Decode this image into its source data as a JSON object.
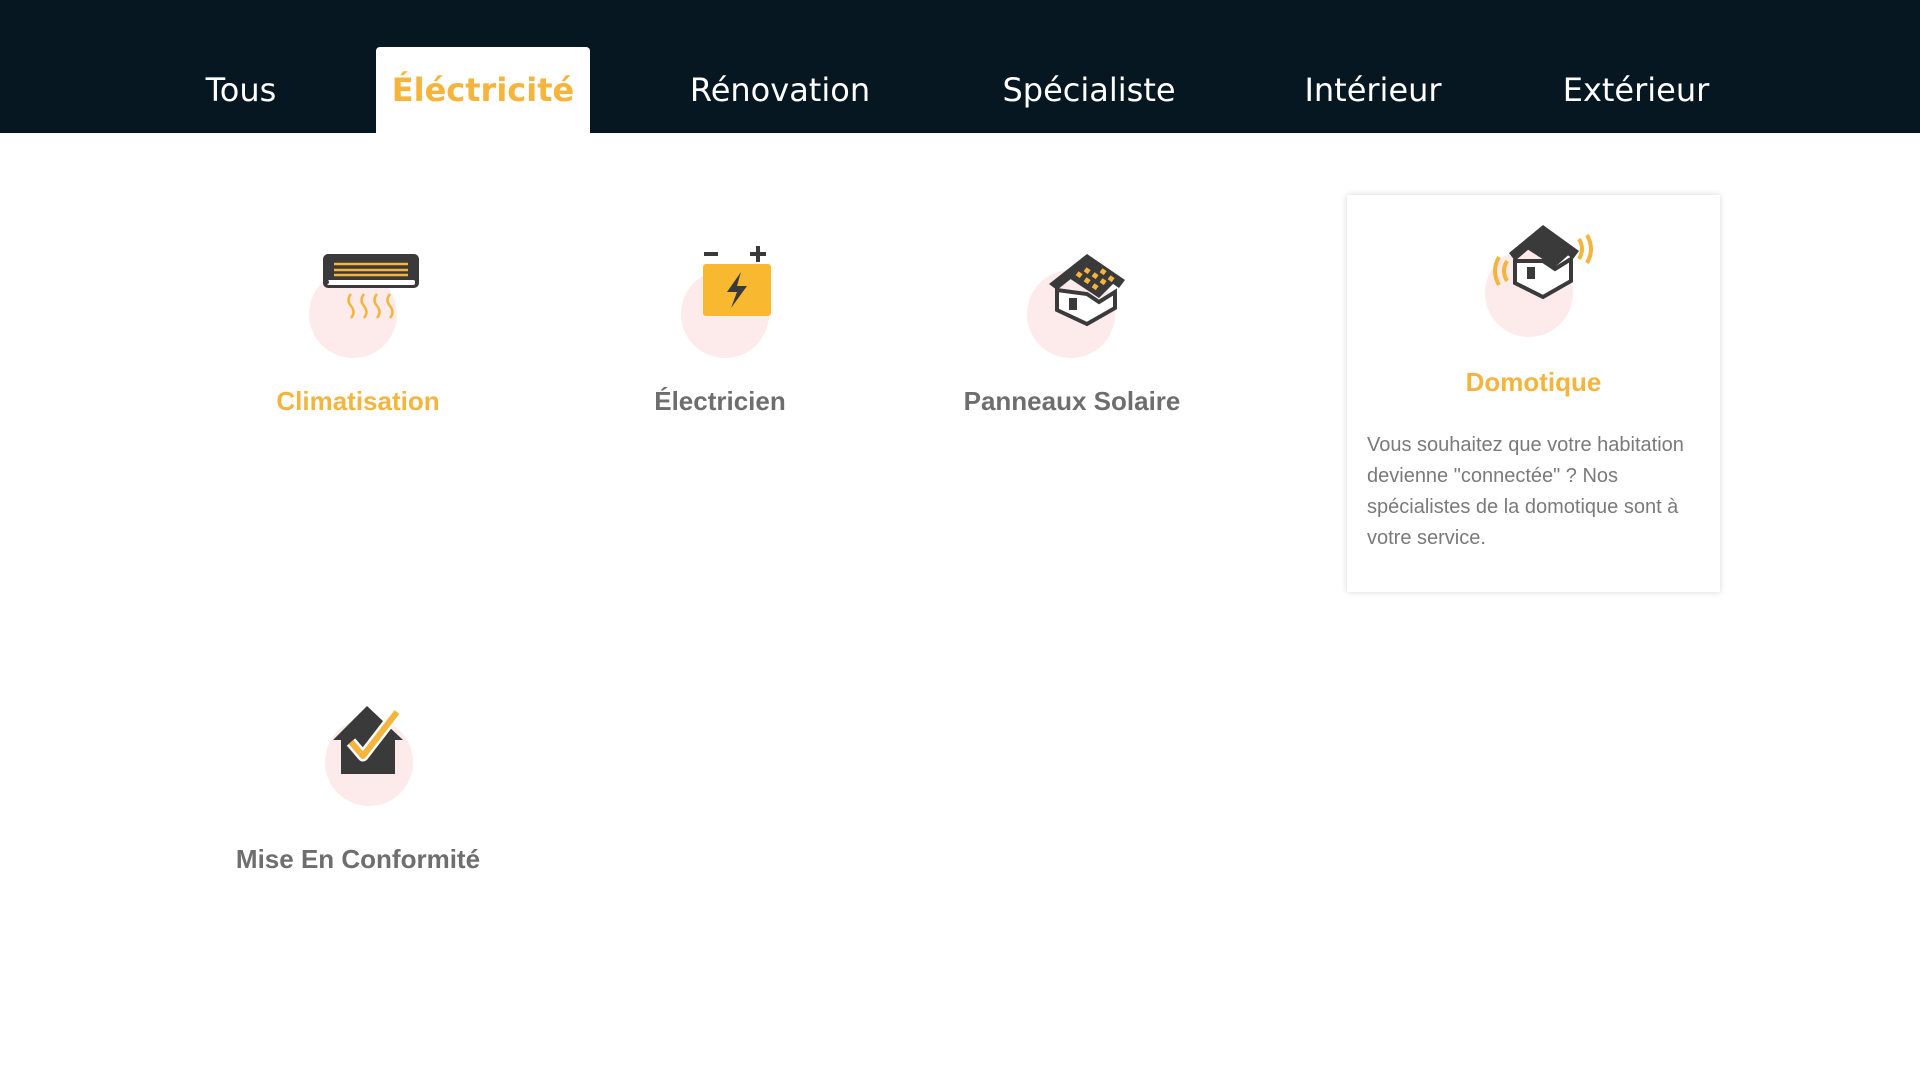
{
  "tabs": [
    {
      "label": "Tous",
      "active": false
    },
    {
      "label": "Éléctricité",
      "active": true
    },
    {
      "label": "Rénovation",
      "active": false
    },
    {
      "label": "Spécialiste",
      "active": false
    },
    {
      "label": "Intérieur",
      "active": false
    },
    {
      "label": "Extérieur",
      "active": false
    }
  ],
  "services": [
    {
      "label": "Climatisation",
      "icon": "air-conditioner-icon"
    },
    {
      "label": "Électricien",
      "icon": "battery-charge-icon"
    },
    {
      "label": "Panneaux Solaire",
      "icon": "solar-house-icon"
    },
    {
      "label": "Domotique",
      "icon": "smart-home-icon",
      "description": "Vous souhaitez que votre habitation devienne \"connectée\" ? Nos spécialistes de la domotique sont à votre service."
    },
    {
      "label": "Mise En Conformité",
      "icon": "house-check-icon"
    }
  ],
  "colors": {
    "topbar": "#071722",
    "accent": "#f5b43c",
    "icon_dark": "#3a3a3a",
    "blob": "#fcebea",
    "text_gray": "#6e6e6e"
  }
}
